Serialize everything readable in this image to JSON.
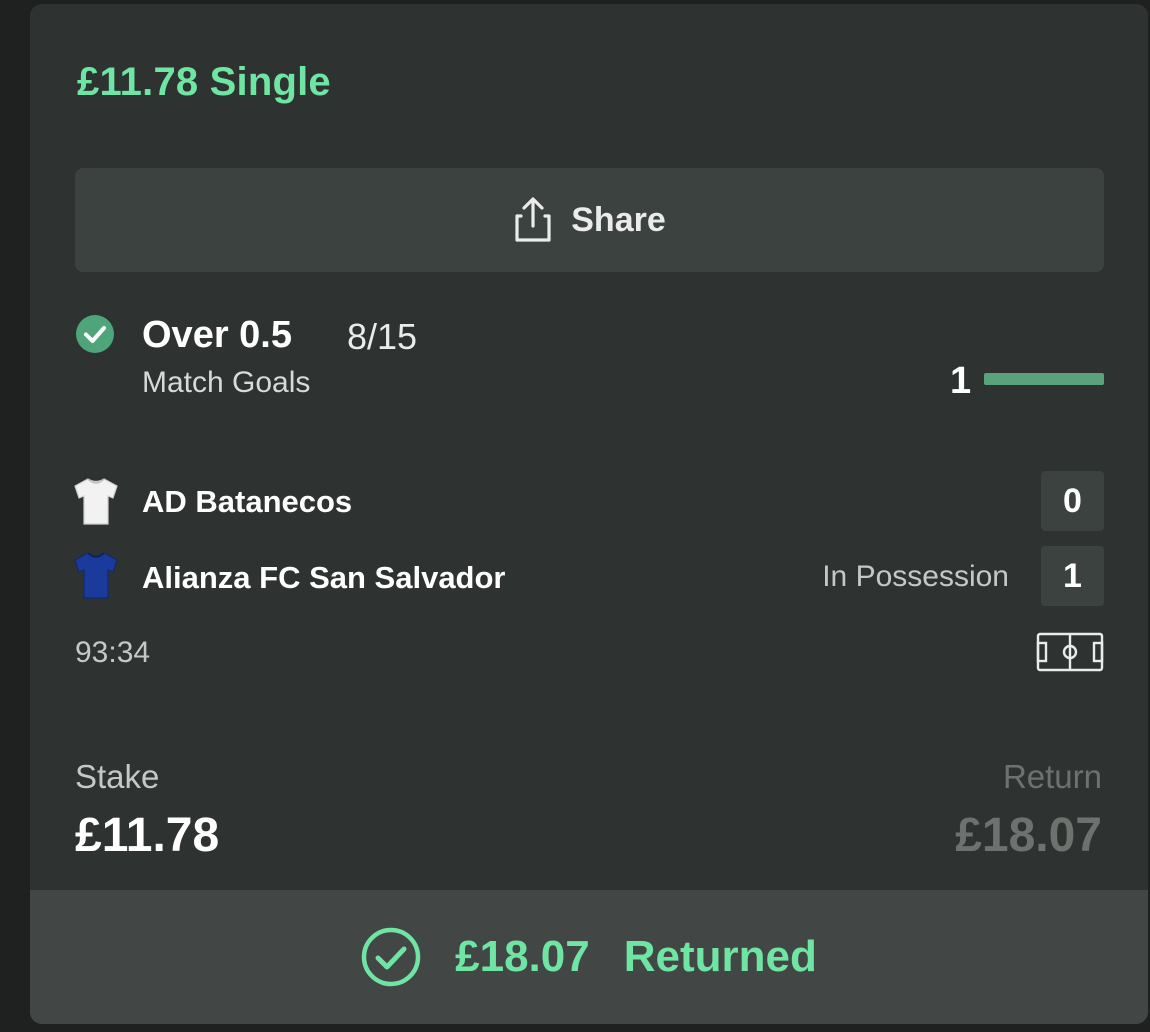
{
  "bet": {
    "title": "£11.78 Single",
    "share_label": "Share",
    "selection": {
      "name": "Over 0.5",
      "odds": "8/15",
      "market": "Match Goals",
      "goal_count": "1",
      "status_icon": "check-circle-icon"
    },
    "match": {
      "home": {
        "name": "AD Batanecos",
        "score": "0",
        "shirt_color": "#f2f2f2"
      },
      "away": {
        "name": "Alianza FC San Salvador",
        "score": "1",
        "shirt_color": "#1a3a9c"
      },
      "possession": "In Possession",
      "clock": "93:34"
    },
    "stake": {
      "label": "Stake",
      "value": "£11.78"
    },
    "return": {
      "label": "Return",
      "value": "£18.07"
    },
    "result": {
      "amount": "£18.07",
      "status": "Returned"
    }
  },
  "colors": {
    "accent": "#6fe5a3",
    "card_bg": "#2e3331",
    "button_bg": "#3c423f",
    "footer_bg": "#424745",
    "check_green": "#4ea57a"
  }
}
